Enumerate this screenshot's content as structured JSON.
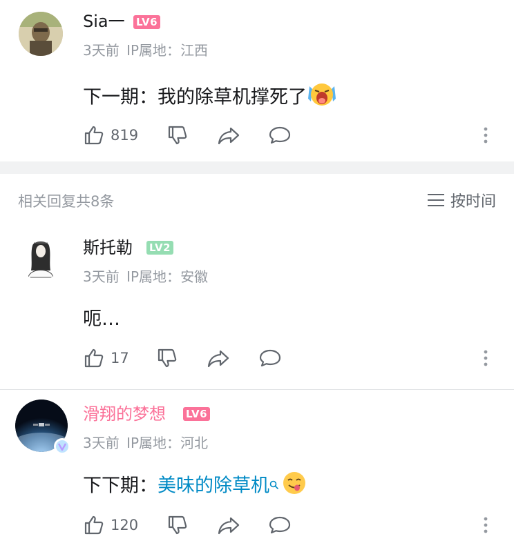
{
  "comments": [
    {
      "username": "Sia一",
      "level": "LV6",
      "time": "3天前",
      "ip_label": "IP属地：",
      "ip_location": "江西",
      "text": "下一期：我的除草机撑死了",
      "emoji": "crying-face-emoji",
      "likes": "819"
    },
    {
      "username": "斯托勒",
      "level": "LV2",
      "time": "3天前",
      "ip_label": "IP属地：",
      "ip_location": "安徽",
      "text": "呃…",
      "likes": "17"
    },
    {
      "username": "滑翔的梦想",
      "level": "LV6",
      "time": "3天前",
      "ip_label": "IP属地：",
      "ip_location": "河北",
      "text_prefix": "下下期：",
      "text_link": "美味的除草机",
      "emoji": "yummy-face-emoji",
      "likes": "120"
    }
  ],
  "reply_header": {
    "count_label": "相关回复共8条",
    "sort_label": "按时间"
  },
  "colors": {
    "lv6": "#fb7299",
    "lv2": "#95ddb2",
    "vip_name": "#fb7299",
    "link": "#008ac5",
    "meta": "#9499a0",
    "icon": "#61666d"
  }
}
